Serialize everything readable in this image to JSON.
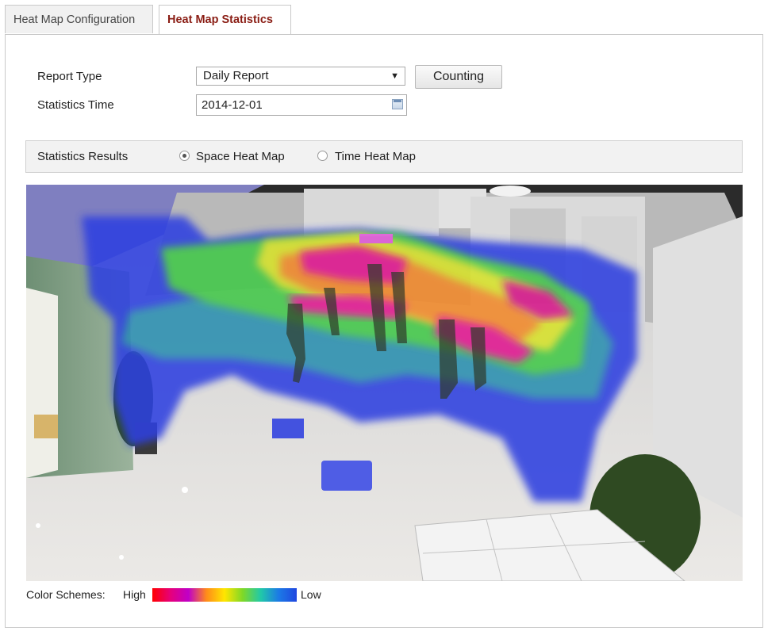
{
  "tabs": [
    {
      "label": "Heat Map Configuration",
      "active": false
    },
    {
      "label": "Heat Map Statistics",
      "active": true
    }
  ],
  "form": {
    "report_type_label": "Report Type",
    "report_type_value": "Daily Report",
    "counting_button": "Counting",
    "statistics_time_label": "Statistics Time",
    "statistics_time_value": "2014-12-01"
  },
  "results": {
    "label": "Statistics Results",
    "options": [
      {
        "label": "Space Heat Map",
        "selected": true
      },
      {
        "label": "Time Heat Map",
        "selected": false
      }
    ]
  },
  "legend": {
    "label": "Color Schemes:",
    "high": "High",
    "low": "Low",
    "gradient": [
      "#ff0000",
      "#e6007a",
      "#c000c8",
      "#ff8c1a",
      "#ffe600",
      "#7fd827",
      "#21c9a8",
      "#1c7ae6",
      "#1f47e0"
    ]
  },
  "colors": {
    "active_tab_text": "#8a1d14",
    "heat_blue": "#2e3fe0",
    "heat_green": "#42c84a",
    "heat_magenta": "#e01890"
  }
}
